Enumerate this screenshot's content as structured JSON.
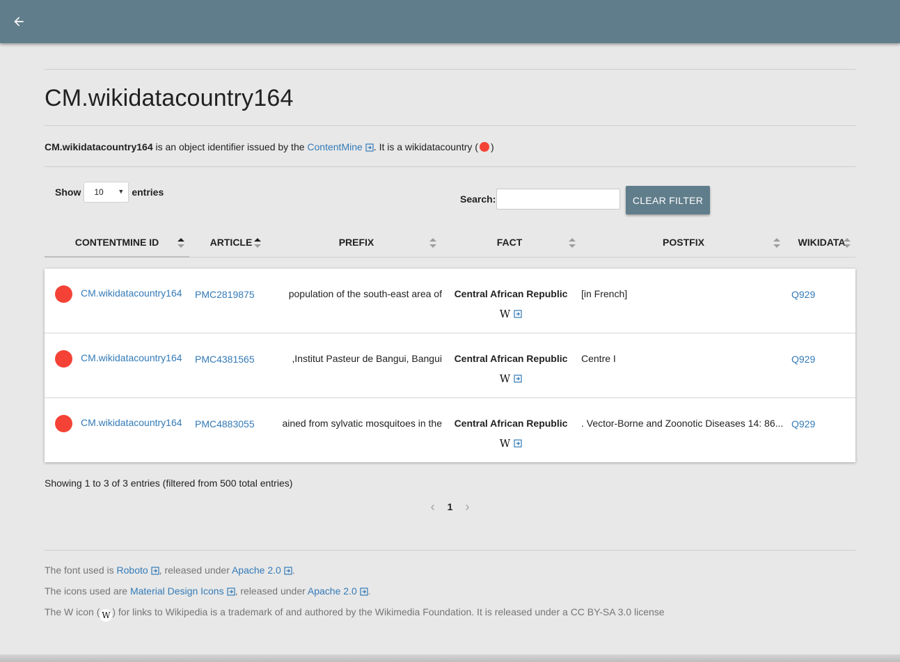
{
  "page": {
    "title": "CM.wikidatacountry164",
    "description": {
      "id_bold": "CM.wikidatacountry164",
      "text1": " is an object identifier issued by the ",
      "issuer_link": "ContentMine",
      "text2": ". It is a wikidatacountry (",
      "text3": ")"
    }
  },
  "controls": {
    "show_label": "Show",
    "entries_value": "10",
    "entries_label": "entries",
    "search_label": "Search:",
    "search_value": "",
    "clear_filter": "CLEAR FILTER"
  },
  "table": {
    "columns": [
      "CONTENTMINE ID",
      "ARTICLE",
      "PREFIX",
      "FACT",
      "POSTFIX",
      "WIKIDATA"
    ],
    "rows": [
      {
        "id": "CM.wikidatacountry164",
        "article": "PMC2819875",
        "prefix": "population of the south-east area of",
        "fact": "Central African Republic",
        "postfix": "[in French]",
        "wikidata": "Q929"
      },
      {
        "id": "CM.wikidatacountry164",
        "article": "PMC4381565",
        "prefix": ",Institut Pasteur de Bangui, Bangui",
        "fact": "Central African Republic",
        "postfix": "Centre I",
        "wikidata": "Q929"
      },
      {
        "id": "CM.wikidatacountry164",
        "article": "PMC4883055",
        "prefix": "ained from sylvatic mosquitoes in the",
        "fact": "Central African Republic",
        "postfix": ". Vector-Borne and Zoonotic Diseases 14: 86...",
        "wikidata": "Q929"
      }
    ]
  },
  "info": "Showing 1 to 3 of 3 entries (filtered from 500 total entries)",
  "pagination": {
    "current": "1"
  },
  "credits": {
    "font_text1": "The font used is ",
    "font_link": "Roboto",
    "font_text2": ", released under ",
    "font_license": "Apache 2.0",
    "font_text3": ".",
    "icons_text1": "The icons used are ",
    "icons_link": "Material Design Icons",
    "icons_text2": ", released under ",
    "icons_license": "Apache 2.0",
    "icons_text3": ".",
    "w_text1": "The W icon (",
    "w_glyph": "W",
    "w_text2": ") for links to Wikipedia is a trademark of and authored by the Wikimedia Foundation. It is released under a CC BY-SA 3.0 license"
  },
  "colors": {
    "topbar": "#607d8b",
    "accent_dot": "#f44336",
    "link": "#337ab7"
  },
  "icons": {
    "back": "arrow-left-icon",
    "external": "external-link-icon",
    "wikipedia": "wikipedia-w-icon"
  }
}
